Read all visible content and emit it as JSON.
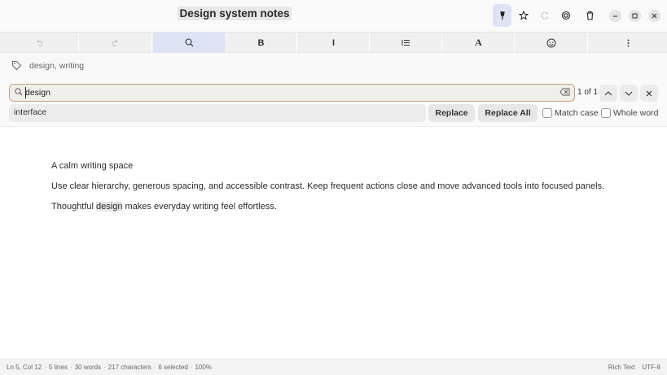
{
  "window": {
    "title": "Design system notes"
  },
  "headerbar": {
    "pin_icon": "pin-icon",
    "star_icon": "star-icon",
    "sync_icon": "sync-icon",
    "settings_icon": "gear-icon",
    "trash_icon": "trash-icon",
    "minimize_icon": "minimize-icon",
    "maximize_icon": "maximize-icon",
    "close_icon": "close-icon"
  },
  "toolbar": {
    "undo_icon": "undo-icon",
    "redo_icon": "redo-icon",
    "search_icon": "search-icon",
    "bold_label": "B",
    "italic_label": "I",
    "list_icon": "list-icon",
    "font_label": "A",
    "emoji_icon": "emoji-icon",
    "more_icon": "more-icon"
  },
  "tags": {
    "icon": "tag-icon",
    "text": "design, writing"
  },
  "search": {
    "query": "design",
    "match_count": "1 of 1",
    "replace_value": "interface",
    "replace_label": "Replace",
    "replace_all_label": "Replace All",
    "match_case_label": "Match case",
    "whole_word_label": "Whole word",
    "match_case_checked": false,
    "whole_word_checked": false
  },
  "document": {
    "heading": "A calm writing space",
    "paragraph1": "Use clear hierarchy, generous spacing, and accessible contrast. Keep frequent actions close and move advanced tools into focused panels.",
    "paragraph2_before": "Thoughtful ",
    "paragraph2_match": "design",
    "paragraph2_after": " makes everyday writing feel effortless."
  },
  "status": {
    "position": "Ln 5, Col 12",
    "lines": "5 lines",
    "words": "30 words",
    "characters": "217 characters",
    "selected": "6 selected",
    "zoom": "100%",
    "format": "Rich Text",
    "encoding": "UTF-8"
  },
  "colors": {
    "accent_active": "#dde3f5",
    "search_border": "#c29d80",
    "search_bg": "#f1efeb"
  }
}
